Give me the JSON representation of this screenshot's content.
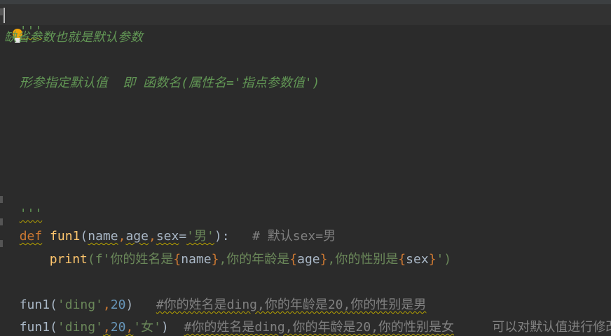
{
  "editor": {
    "doc_open": "'''",
    "doc_line1": "缺省参数也就是默认参数",
    "doc_line2": "  形参指定默认值  即 函数名(属性名='指点参数值')",
    "doc_close": "'''",
    "def_kw": "def",
    "func_name": "fun1",
    "params_open": "(",
    "param_name": "name",
    "comma": ",",
    "param_age": "age",
    "param_sex": "sex",
    "eq": "=",
    "default_sex": "'男'",
    "params_close": "):",
    "def_comment": "# 默认sex=男",
    "print_fn": "print",
    "fstr_prefix": "(f'你的姓名是",
    "brace_open": "{",
    "brace_close": "}",
    "var_name": "name",
    "fstr_mid1": ",你的年龄是",
    "var_age": "age",
    "fstr_mid2": ",你的性别是",
    "var_sex": "sex",
    "fstr_end": "')",
    "call1_fn": "fun1",
    "call1_str": "'ding'",
    "call1_num": "20",
    "call1_close": ")",
    "call1_comment": "#你的姓名是ding,你的年龄是20,你的性别是男",
    "call2_fn": "fun1",
    "call2_str": "'ding'",
    "call2_num": "20",
    "call2_sex": "'女'",
    "call2_close": ")",
    "call2_comment": "#你的姓名是ding,你的年龄是20,你的性别是女",
    "call2_note": "可以对默认值进行修改"
  },
  "icons": {
    "intention_bulb": "lightbulb-icon"
  }
}
